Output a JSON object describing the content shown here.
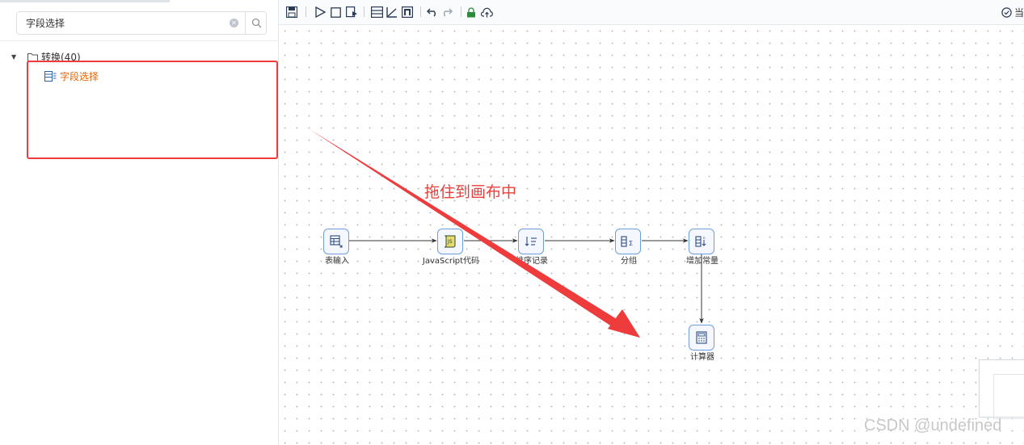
{
  "search": {
    "value": "字段选择"
  },
  "tree": {
    "root_label": "转换(40)",
    "child_label": "字段选择"
  },
  "toolbar": {
    "icons": [
      "save-icon",
      "run-icon",
      "stop-icon",
      "preview-icon",
      "align-icon",
      "distribute-icon",
      "layout-icon",
      "undo-icon",
      "redo-icon",
      "lock-icon",
      "upload-icon"
    ],
    "right_label": "当",
    "right_icon": "check-circle-icon"
  },
  "canvas": {
    "annotation": "拖住到画布中",
    "nodes": [
      {
        "id": "table-input",
        "label": "表输入",
        "icon": "table-input-icon"
      },
      {
        "id": "javascript",
        "label": "JavaScript代码",
        "icon": "javascript-icon"
      },
      {
        "id": "sort-rows",
        "label": "排序记录",
        "icon": "sort-icon"
      },
      {
        "id": "group-by",
        "label": "分组",
        "icon": "group-sum-icon"
      },
      {
        "id": "add-constants",
        "label": "增加常量",
        "icon": "add-constant-icon"
      },
      {
        "id": "calculator",
        "label": "计算器",
        "icon": "calculator-icon"
      }
    ]
  },
  "watermark": "CSDN @undefined",
  "colors": {
    "accent_orange": "#e6650a",
    "annotation_red": "#e8403a",
    "node_border": "#6f9cdc"
  }
}
